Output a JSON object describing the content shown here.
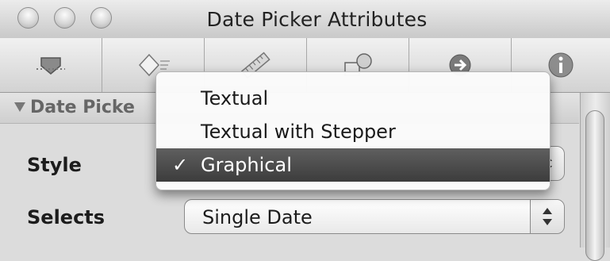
{
  "window": {
    "title": "Date Picker Attributes"
  },
  "toolbar": {
    "items": [
      {
        "icon": "attributes-inspector-icon"
      },
      {
        "icon": "effects-inspector-icon"
      },
      {
        "icon": "size-inspector-icon"
      },
      {
        "icon": "bindings-inspector-icon"
      },
      {
        "icon": "connections-inspector-icon"
      },
      {
        "icon": "identity-info-icon"
      }
    ]
  },
  "section": {
    "label": "Date Picke"
  },
  "form": {
    "style_label": "Style",
    "selects_label": "Selects",
    "selects_value": "Single Date"
  },
  "menu": {
    "items": [
      {
        "label": "Textual",
        "selected": false
      },
      {
        "label": "Textual with Stepper",
        "selected": false
      },
      {
        "label": "Graphical",
        "selected": true
      }
    ],
    "check_mark": "✓"
  },
  "colors": {
    "selected_item_bg": "#4a4a4a",
    "window_bg": "#dcdcdc"
  }
}
